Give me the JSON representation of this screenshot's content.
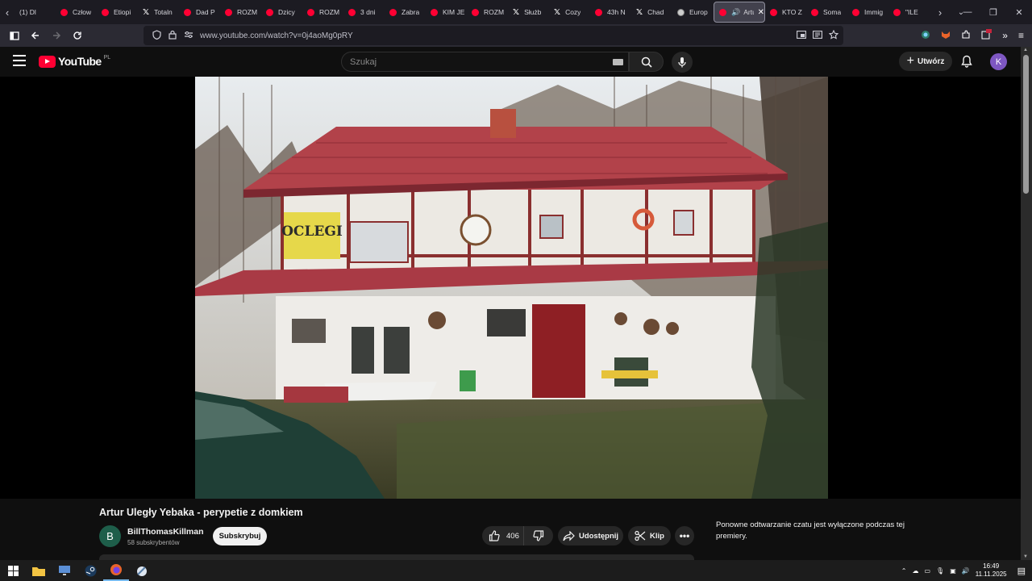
{
  "browser": {
    "tabs": [
      {
        "title": "(1) Dl",
        "icon": "none"
      },
      {
        "title": "Człow",
        "icon": "youtube-icon"
      },
      {
        "title": "Etiopi",
        "icon": "youtube-icon"
      },
      {
        "title": "Totaln",
        "icon": "x-icon"
      },
      {
        "title": "Dad P",
        "icon": "youtube-icon"
      },
      {
        "title": "ROZM",
        "icon": "youtube-icon"
      },
      {
        "title": "Dzicy",
        "icon": "youtube-icon"
      },
      {
        "title": "ROZM",
        "icon": "youtube-icon"
      },
      {
        "title": "3 dni",
        "icon": "youtube-icon"
      },
      {
        "title": "Zabra",
        "icon": "youtube-icon"
      },
      {
        "title": "KIM JE",
        "icon": "youtube-icon"
      },
      {
        "title": "ROZM",
        "icon": "youtube-icon"
      },
      {
        "title": "Służb",
        "icon": "x-icon"
      },
      {
        "title": "Cozy",
        "icon": "x-icon"
      },
      {
        "title": "43h N",
        "icon": "youtube-icon"
      },
      {
        "title": "Chad",
        "icon": "x-icon"
      },
      {
        "title": "Europ",
        "icon": "globe-icon"
      },
      {
        "title": "Artu",
        "icon": "youtube-icon",
        "active": true
      },
      {
        "title": "KTO Z",
        "icon": "youtube-icon"
      },
      {
        "title": "Soma",
        "icon": "youtube-icon"
      },
      {
        "title": "Immig",
        "icon": "youtube-icon"
      },
      {
        "title": "\"ILE",
        "icon": "youtube-icon"
      }
    ],
    "url": "www.youtube.com/watch?v=0j4aoMg0pRY"
  },
  "youtube": {
    "logo_text": "YouTube",
    "region": "PL",
    "search_placeholder": "Szukaj",
    "create_label": "Utwórz",
    "avatar_letter": "K",
    "video_title": "Artur Uległy Yebaka - perypetie z domkiem",
    "sign_text": "OCLEGI",
    "channel": {
      "avatar_letter": "B",
      "name": "BillThomasKillman",
      "subscribers": "58 subskrybentów",
      "subscribe_label": "Subskrybuj"
    },
    "actions": {
      "likes": "406",
      "share_label": "Udostępnij",
      "clip_label": "Klip",
      "more_label": "•••"
    },
    "chat_message": "Ponowne odtwarzanie czatu jest wyłączone podczas tej premiery."
  },
  "taskbar": {
    "time": "16:49",
    "date": "11.11.2025"
  }
}
